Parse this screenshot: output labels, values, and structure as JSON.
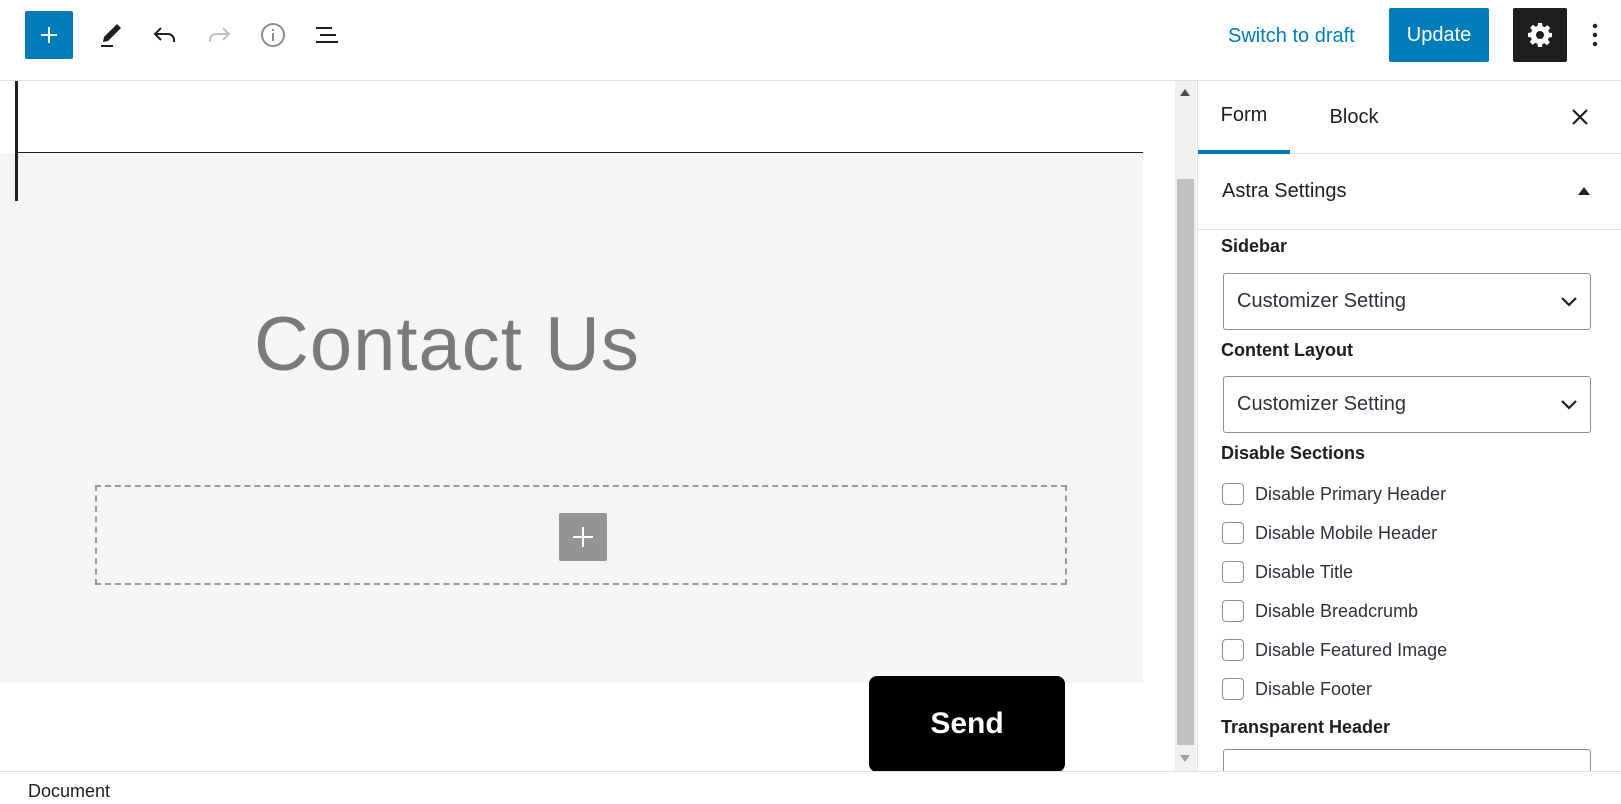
{
  "toolbar": {
    "icons": [
      "plus-icon",
      "pencil-icon",
      "undo-icon",
      "redo-icon",
      "info-icon",
      "list-view-icon",
      "gear-icon",
      "more-vertical-icon"
    ],
    "switch_to_draft": "Switch to draft",
    "update": "Update",
    "accent_color": "#007cba"
  },
  "canvas": {
    "heading": "Contact Us",
    "send_button": "Send"
  },
  "sidebar": {
    "tabs": [
      {
        "label": "Form",
        "active": true
      },
      {
        "label": "Block",
        "active": false
      }
    ],
    "panel_title": "Astra Settings",
    "sidebar_label": "Sidebar",
    "sidebar_value": "Customizer Setting",
    "content_layout_label": "Content Layout",
    "content_layout_value": "Customizer Setting",
    "disable_sections_label": "Disable Sections",
    "checkboxes": [
      {
        "label": "Disable Primary Header",
        "checked": false
      },
      {
        "label": "Disable Mobile Header",
        "checked": false
      },
      {
        "label": "Disable Title",
        "checked": false
      },
      {
        "label": "Disable Breadcrumb",
        "checked": false
      },
      {
        "label": "Disable Featured Image",
        "checked": false
      },
      {
        "label": "Disable Footer",
        "checked": false
      }
    ],
    "transparent_header_label": "Transparent Header"
  },
  "footer": {
    "breadcrumb": "Document"
  }
}
